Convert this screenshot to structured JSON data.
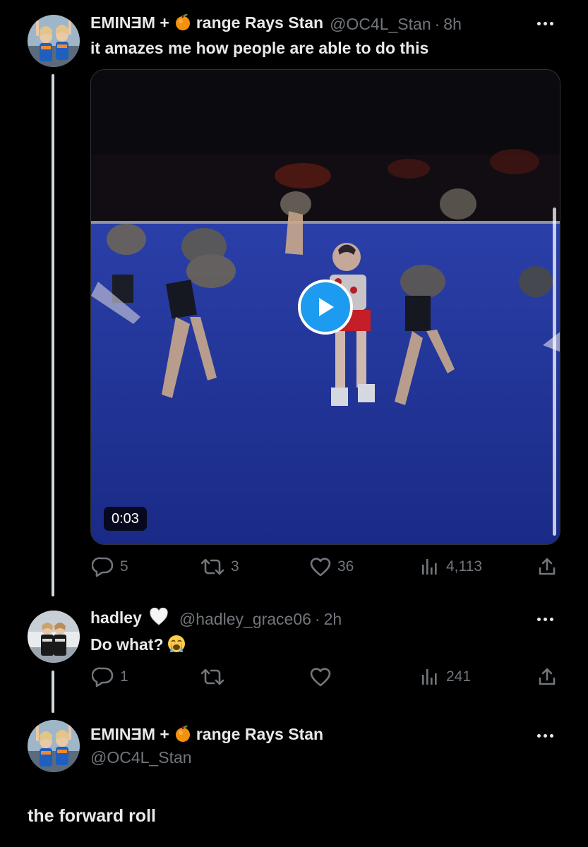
{
  "tweet1": {
    "author": {
      "name_pre": "EMINƎM +",
      "name_post": "range Rays Stan",
      "emoji": "orange-emoji",
      "handle": "@OC4L_Stan",
      "separator": "·",
      "time": "8h"
    },
    "text": "it amazes me how people are able to do this",
    "video": {
      "duration": "0:03",
      "play_icon": "play-icon"
    },
    "actions": {
      "replies": "5",
      "retweets": "3",
      "likes": "36",
      "views": "4,113"
    }
  },
  "tweet2": {
    "author": {
      "name": "hadley",
      "emoji": "white-heart-emoji",
      "handle": "@hadley_grace06",
      "separator": "·",
      "time": "2h"
    },
    "text": "Do what?",
    "text_emoji": "loudly-crying-face-emoji",
    "actions": {
      "replies": "1",
      "retweets": "",
      "likes": "",
      "views": "241"
    }
  },
  "tweet3": {
    "author": {
      "name_pre": "EMINƎM +",
      "name_post": "range Rays Stan",
      "emoji": "orange-emoji",
      "handle": "@OC4L_Stan"
    },
    "text": "the forward roll"
  },
  "colors": {
    "background": "#000000",
    "primary_text": "#e7e9ea",
    "secondary_text": "#71767b",
    "accent": "#1d9bf0",
    "thread_line": "#cfd9de"
  },
  "icons": [
    "more-icon",
    "reply-icon",
    "retweet-icon",
    "like-icon",
    "views-icon",
    "share-icon",
    "play-icon"
  ]
}
